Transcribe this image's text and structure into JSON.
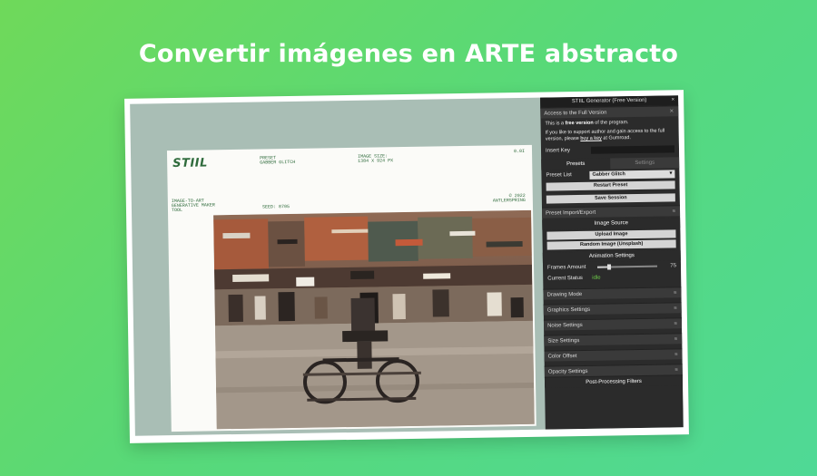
{
  "headline": "Convertir imágenes en ARTE abstracto",
  "sheet": {
    "logo": "STIIL",
    "preset_label": "PRESET",
    "preset_value": "GABBER GLITCH",
    "size_label": "IMAGE SIZE:",
    "size_value": "1384 X 924 PX",
    "page_num": "0.0I",
    "tagline_1": "IMAGE-TO-ART",
    "tagline_2": "GENERATIVE MAKER",
    "tagline_3": "TOOL",
    "seed": "SEED: 8705",
    "year": "© 2022",
    "author": "ANTLERSPRING"
  },
  "panel": {
    "title": "STIIL Generator (Free Version)",
    "close": "×",
    "full_version_header": "Access to the Full Version",
    "free_line_pre": "This is a ",
    "free_line_bold": "free version",
    "free_line_post": " of the program.",
    "support_pre": "If you like to support author and gain access to the full version, please ",
    "support_link": "buy a key",
    "support_post": " at Gumroad.",
    "insert_key_label": "Insert Key",
    "insert_key_value": "",
    "tab_presets": "Presets",
    "tab_settings": "Settings",
    "preset_list_label": "Preset List",
    "preset_selected": "Gabber Glitch",
    "restart_preset": "Restart Preset",
    "save_session": "Save Session",
    "preset_import_export": "Preset Import/Export",
    "image_source_header": "Image Source",
    "upload_image": "Upload Image",
    "random_image": "Random Image (Unsplash)",
    "animation_header": "Animation Settings",
    "frames_amount_label": "Frames Amount",
    "frames_amount_value": "75",
    "frames_amount_fraction": 0.2,
    "current_status_label": "Current Status",
    "current_status_value": "idle",
    "folders": [
      "Drawing Mode",
      "Graphics Settings",
      "Noise Settings",
      "Size Settings",
      "Color Offset",
      "Opacity Settings"
    ],
    "post_processing": "Post-Processing Filters"
  },
  "colors": {
    "bg_start": "#6fd95a",
    "bg_end": "#4fd996",
    "accent_green": "#2f6b3c",
    "panel_bg": "#2b2b2b",
    "app_bg": "#a9beb5",
    "status_green": "#6fcf4a"
  }
}
